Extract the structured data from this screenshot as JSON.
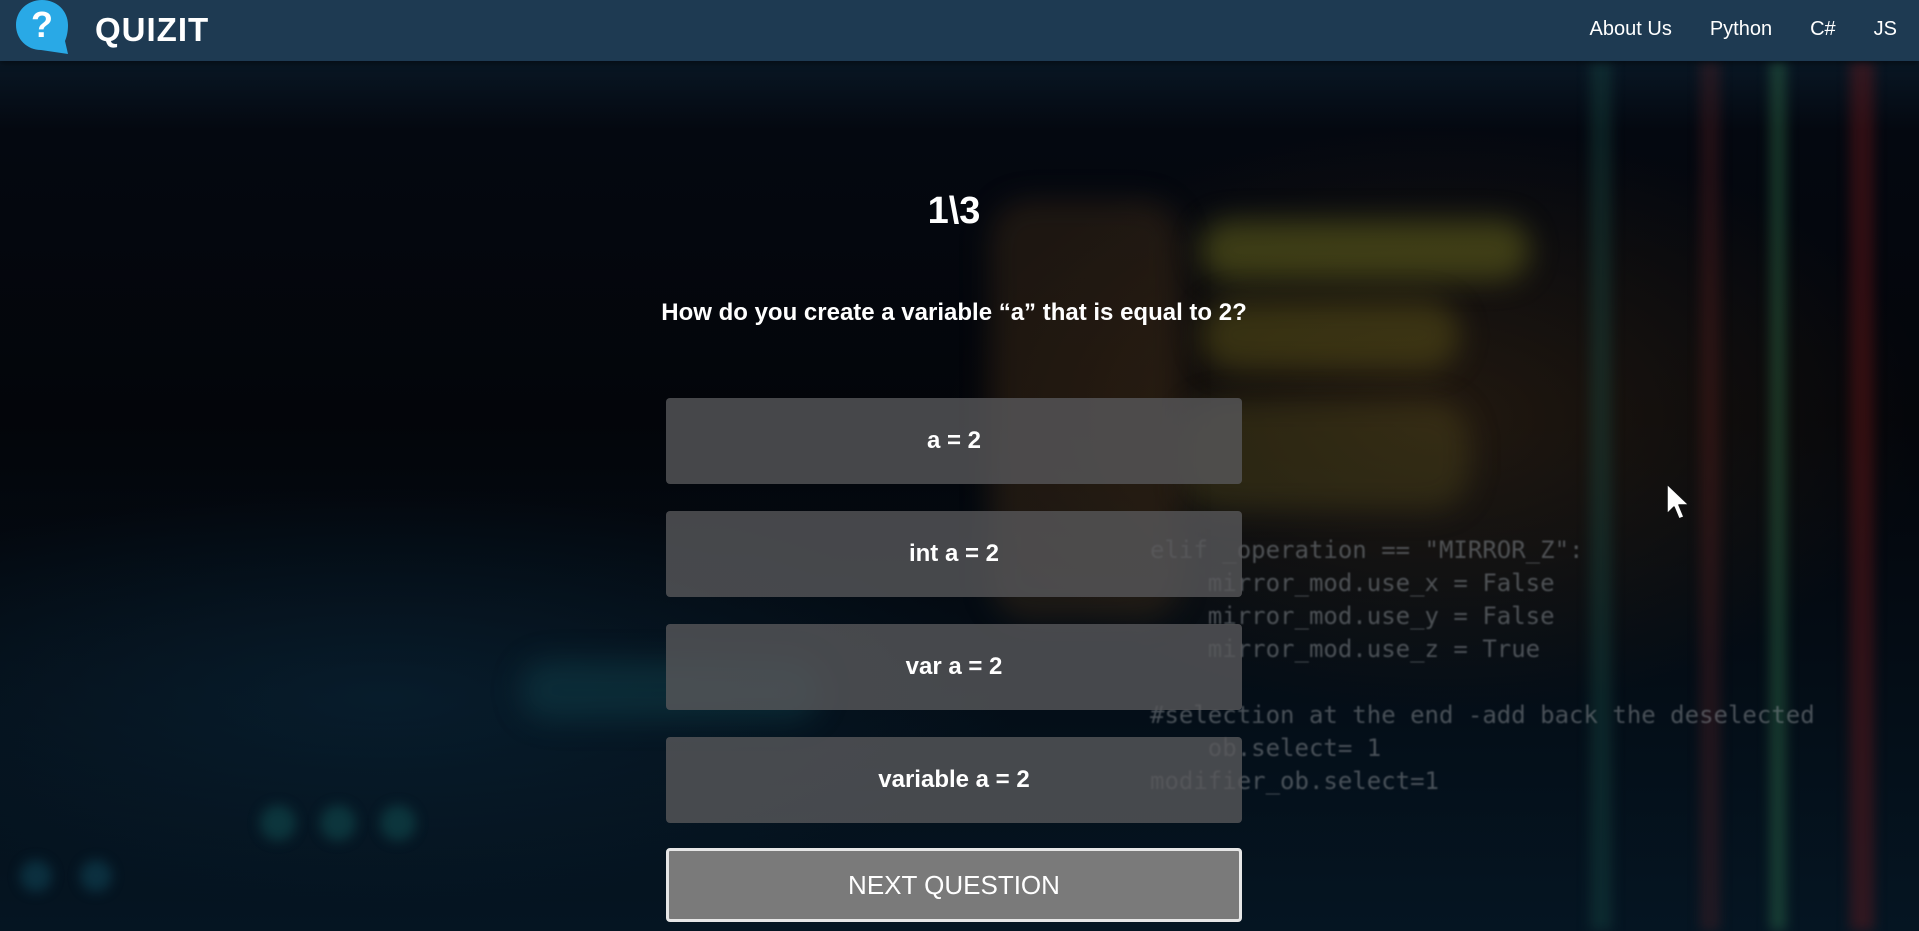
{
  "header": {
    "brand": "QUIZIT",
    "logo_icon": "question-bubble-icon",
    "nav": [
      {
        "label": "About Us"
      },
      {
        "label": "Python"
      },
      {
        "label": "C#"
      },
      {
        "label": "JS"
      }
    ]
  },
  "quiz": {
    "counter": "1\\3",
    "question": "How do you create a variable “a” that is equal to 2?",
    "answers": [
      {
        "label": "a = 2"
      },
      {
        "label": "int a = 2"
      },
      {
        "label": "var a = 2"
      },
      {
        "label": "variable a = 2"
      }
    ],
    "next_label": "NEXT QUESTION"
  },
  "background_code": [
    "elif _operation == \"MIRROR_Z\":",
    "    mirror_mod.use_x = False",
    "    mirror_mod.use_y = False",
    "    mirror_mod.use_z = True",
    "",
    "#selection at the end -add back the deselected",
    "    ob.select= 1",
    "modifier_ob.select=1"
  ],
  "colors": {
    "header_bg": "#1e3a52",
    "answer_bg": "#58585a",
    "next_bg": "#7a7a7a",
    "logo_blue": "#29a9e6"
  }
}
